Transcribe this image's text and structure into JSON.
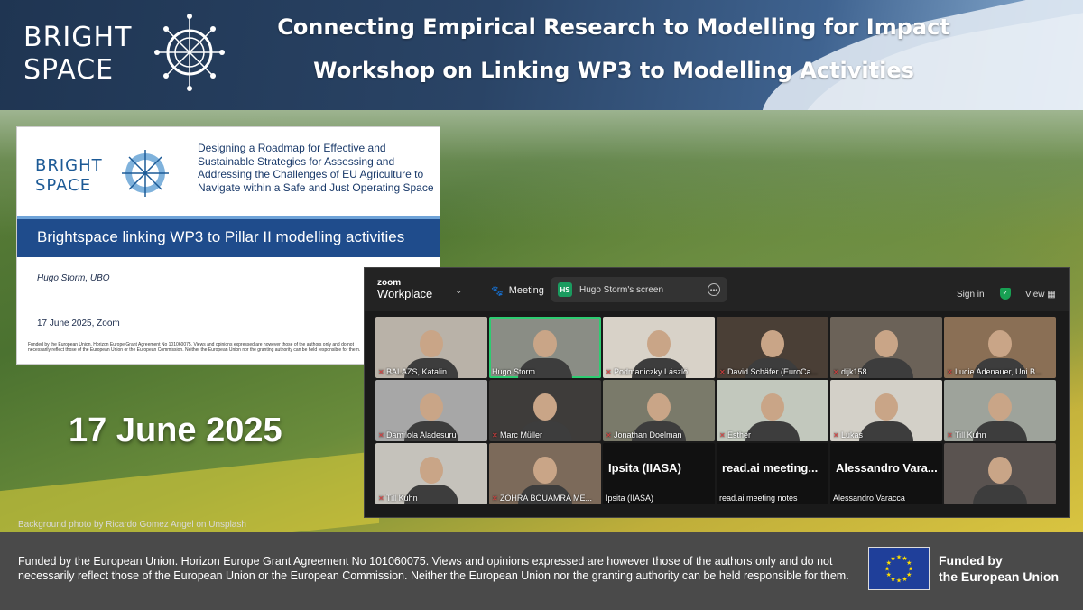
{
  "header": {
    "logo_line1": "BRIGHT",
    "logo_line2": "SPACE",
    "title1": "Connecting Empirical Research to Modelling for Impact",
    "title2": "Workshop on Linking WP3 to Modelling Activities"
  },
  "slide": {
    "logo_line1": "BRIGHT",
    "logo_line2": "SPACE",
    "heading": "Designing a Roadmap for Effective and Sustainable Strategies for Assessing and Addressing the Challenges of EU Agriculture to Navigate within a Safe and Just Operating Space",
    "band_title": "Brightspace linking WP3 to Pillar II modelling activities",
    "author": "Hugo Storm, UBO",
    "date": "17 June 2025, Zoom",
    "footnote": "Funded by the European Union. Horizon Europe Grant Agreement No 101060075. Views and opinions expressed are however those of the authors only and do not necessarily reflect those of the European Union or the European Commission. Neither the European Union nor the granting authority can be held responsible for them."
  },
  "event_date": "17 June 2025",
  "photo_credit": "Background photo by Ricardo Gomez Angel on Unsplash",
  "zoom": {
    "brand_top": "zoom",
    "brand_bottom": "Workplace",
    "meeting_label": "Meeting",
    "screen_badge": "HS",
    "screen_label": "Hugo Storm's screen",
    "signin_label": "Sign in",
    "view_label": "View",
    "participants": [
      {
        "name": "BALAZS, Katalin",
        "muted": true,
        "bg": "#b9b2a8",
        "big": ""
      },
      {
        "name": "Hugo Storm",
        "muted": false,
        "bg": "#8a8d85",
        "big": "",
        "active": true
      },
      {
        "name": "Podmaniczky László",
        "muted": true,
        "bg": "#d8d2c8",
        "big": ""
      },
      {
        "name": "David Schäfer (EuroCa...",
        "muted": true,
        "bg": "#4a3f36",
        "big": ""
      },
      {
        "name": "dijk158",
        "muted": true,
        "bg": "#6b6258",
        "big": ""
      },
      {
        "name": "Lucie Adenauer, Uni B...",
        "muted": true,
        "bg": "#8a6f55",
        "big": ""
      },
      {
        "name": "Damilola Aladesuru",
        "muted": true,
        "bg": "#a7a7a7",
        "big": ""
      },
      {
        "name": "Marc Müller",
        "muted": true,
        "bg": "#3e3c3a",
        "big": ""
      },
      {
        "name": "Jonathan Doelman",
        "muted": true,
        "bg": "#7a7a6a",
        "big": ""
      },
      {
        "name": "Esther",
        "muted": true,
        "bg": "#c2c8bd",
        "big": ""
      },
      {
        "name": "Lukas",
        "muted": true,
        "bg": "#d3d0c8",
        "big": ""
      },
      {
        "name": "Till Kuhn",
        "muted": true,
        "bg": "#9ea39b",
        "big": ""
      },
      {
        "name": "Till Kuhn",
        "muted": true,
        "bg": "#c5c2bb",
        "big": ""
      },
      {
        "name": "ZOHRA BOUAMRA ME...",
        "muted": true,
        "bg": "#7c6a5a",
        "big": ""
      },
      {
        "name": "Ipsita (IIASA)",
        "muted": false,
        "bg": "#111111",
        "big": "Ipsita (IIASA)"
      },
      {
        "name": "read.ai meeting notes",
        "muted": false,
        "bg": "#111111",
        "big": "read.ai meeting..."
      },
      {
        "name": "Alessandro Varacca",
        "muted": false,
        "bg": "#111111",
        "big": "Alessandro Vara..."
      },
      {
        "name": "",
        "muted": false,
        "bg": "#5a5350",
        "big": ""
      }
    ]
  },
  "footer": {
    "text": "Funded by the European Union. Horizon Europe Grant Agreement No 101060075. Views and opinions expressed are however those of the authors only and do not necessarily reflect those of the European Union or the European Commission. Neither the European Union nor the granting authority can be held responsible for them.",
    "badge_line1": "Funded by",
    "badge_line2": "the European Union"
  }
}
